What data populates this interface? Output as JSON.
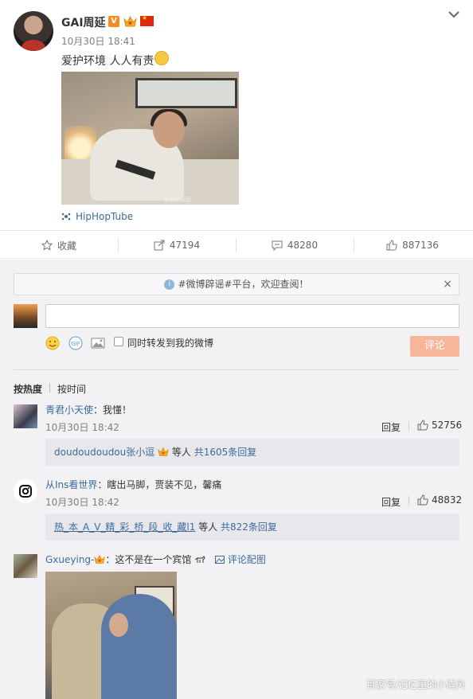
{
  "post": {
    "username": "GAI周延",
    "v_badge": "V",
    "time": "10月30日 18:41",
    "text": "爱护环境 人人有责",
    "image_watermark": "@你的周延",
    "source": "HipHopTube"
  },
  "actions": {
    "favorite": "收藏",
    "forward": "47194",
    "comment": "48280",
    "like": "887136"
  },
  "comment_box": {
    "notice": "#微博辟谣#平台，欢迎查阅！",
    "notice_close": "×",
    "forward_label": "同时转发到我的微博",
    "submit": "评论"
  },
  "sort": {
    "hot": "按热度",
    "time": "按时间"
  },
  "comments": [
    {
      "name": "青君小天使",
      "text": "：我懂！",
      "time": "10月30日 18:42",
      "reply": "回复",
      "likes": "52756",
      "sub_name": "doudoudoudou张小逗",
      "sub_suffix": " 等人 ",
      "sub_count": "共1605条回复"
    },
    {
      "name": "从Ins看世界",
      "text": "：瞎出马脚，贾装不见，馨痛",
      "time": "10月30日 18:42",
      "reply": "回复",
      "likes": "48832",
      "sub_name": "热_本_A_V_精_彩_桥_段_收_藏l1",
      "sub_suffix": " 等人 ",
      "sub_count": "共822条回复"
    },
    {
      "name": "Gxueying-",
      "text": "：这不是在一个宾馆",
      "pic_link": "评论配图"
    }
  ],
  "watermark": "百家号/记忆里的小清风",
  "colors": {
    "link": "#3f6b9a",
    "submit_bg": "#f7b59a",
    "comment_area_bg": "#f2f2f5"
  }
}
